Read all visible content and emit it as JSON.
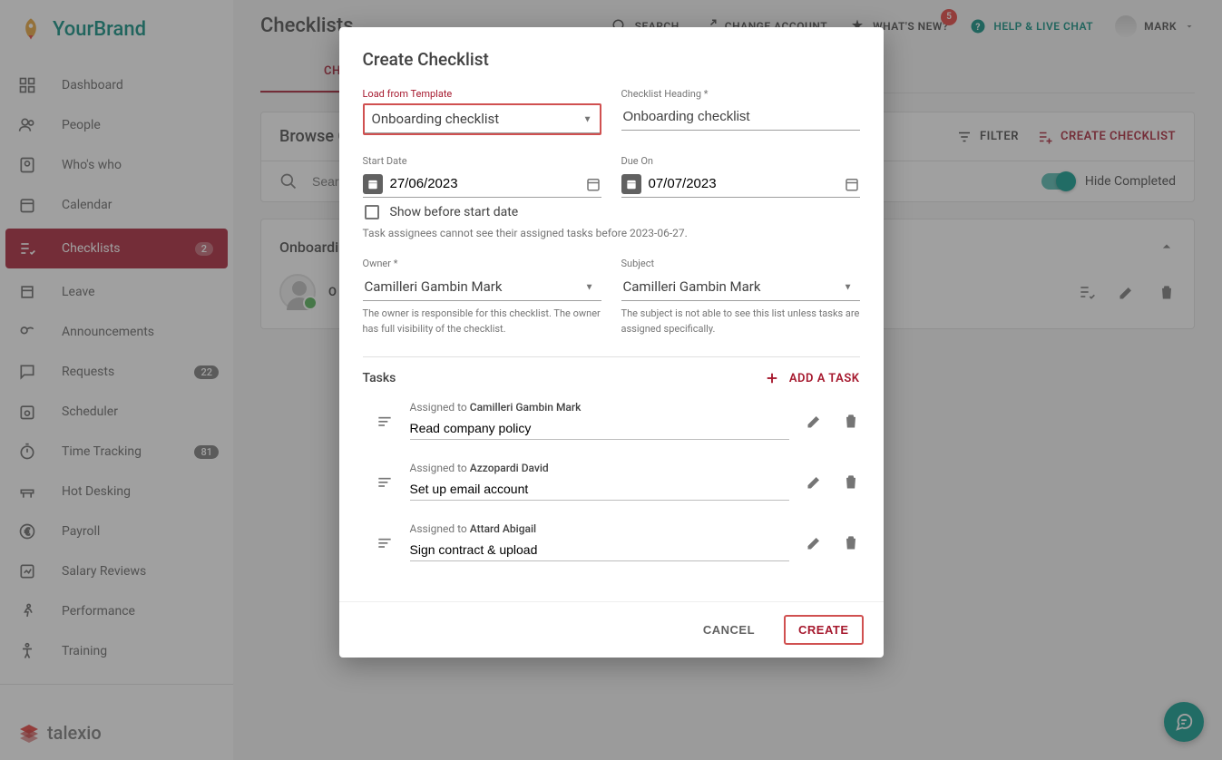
{
  "brand": {
    "name": "YourBrand",
    "color1": "#00897b",
    "color2": "#e6a033"
  },
  "footer_brand": "talexio",
  "sidebar": {
    "items": [
      {
        "label": "Dashboard",
        "icon": "dashboard"
      },
      {
        "label": "People",
        "icon": "people"
      },
      {
        "label": "Who's who",
        "icon": "badge"
      },
      {
        "label": "Calendar",
        "icon": "calendar"
      },
      {
        "label": "Checklists",
        "icon": "checklist",
        "active": true,
        "badge": "2"
      },
      {
        "label": "Leave",
        "icon": "leave"
      },
      {
        "label": "Announcements",
        "icon": "announce"
      },
      {
        "label": "Requests",
        "icon": "requests",
        "badge": "22"
      },
      {
        "label": "Scheduler",
        "icon": "scheduler"
      },
      {
        "label": "Time Tracking",
        "icon": "timer",
        "badge": "81"
      },
      {
        "label": "Hot Desking",
        "icon": "desk"
      },
      {
        "label": "Payroll",
        "icon": "euro"
      },
      {
        "label": "Salary Reviews",
        "icon": "review"
      },
      {
        "label": "Performance",
        "icon": "run"
      },
      {
        "label": "Training",
        "icon": "accessibility"
      }
    ]
  },
  "topbar": {
    "title": "Checklists",
    "search": "SEARCH",
    "change_account": "CHANGE ACCOUNT",
    "whats_new": "WHAT'S NEW?",
    "notif_count": "5",
    "help": "HELP & LIVE CHAT",
    "user": "MARK"
  },
  "tabs": {
    "checklists": "CHECKLI"
  },
  "browse": {
    "title": "Browse Cl",
    "filter": "FILTER",
    "create": "CREATE CHECKLIST",
    "search_placeholder": "Search...",
    "hide_completed": "Hide Completed"
  },
  "card": {
    "title": "Onboardir",
    "owner_label": "O"
  },
  "modal": {
    "title": "Create Checklist",
    "template_label": "Load from Template",
    "template_value": "Onboarding checklist",
    "heading_label": "Checklist Heading *",
    "heading_value": "Onboarding checklist",
    "start_label": "Start Date",
    "start_value": "27/06/2023",
    "due_label": "Due On",
    "due_value": "07/07/2023",
    "show_before": "Show before start date",
    "show_before_helper": "Task assignees cannot see their assigned tasks before 2023-06-27.",
    "owner_label": "Owner *",
    "owner_value": "Camilleri Gambin Mark",
    "owner_helper": "The owner is responsible for this checklist. The owner has full visibility of the checklist.",
    "subject_label": "Subject",
    "subject_value": "Camilleri Gambin Mark",
    "subject_helper": "The subject is not able to see this list unless tasks are assigned specifically.",
    "tasks_label": "Tasks",
    "add_task": "ADD A TASK",
    "assigned_to": "Assigned to",
    "tasks": [
      {
        "assignee": "Camilleri Gambin Mark",
        "title": "Read company policy"
      },
      {
        "assignee": "Azzopardi David",
        "title": "Set up email account"
      },
      {
        "assignee": "Attard Abigail",
        "title": "Sign contract & upload"
      }
    ],
    "cancel": "CANCEL",
    "create": "CREATE"
  }
}
